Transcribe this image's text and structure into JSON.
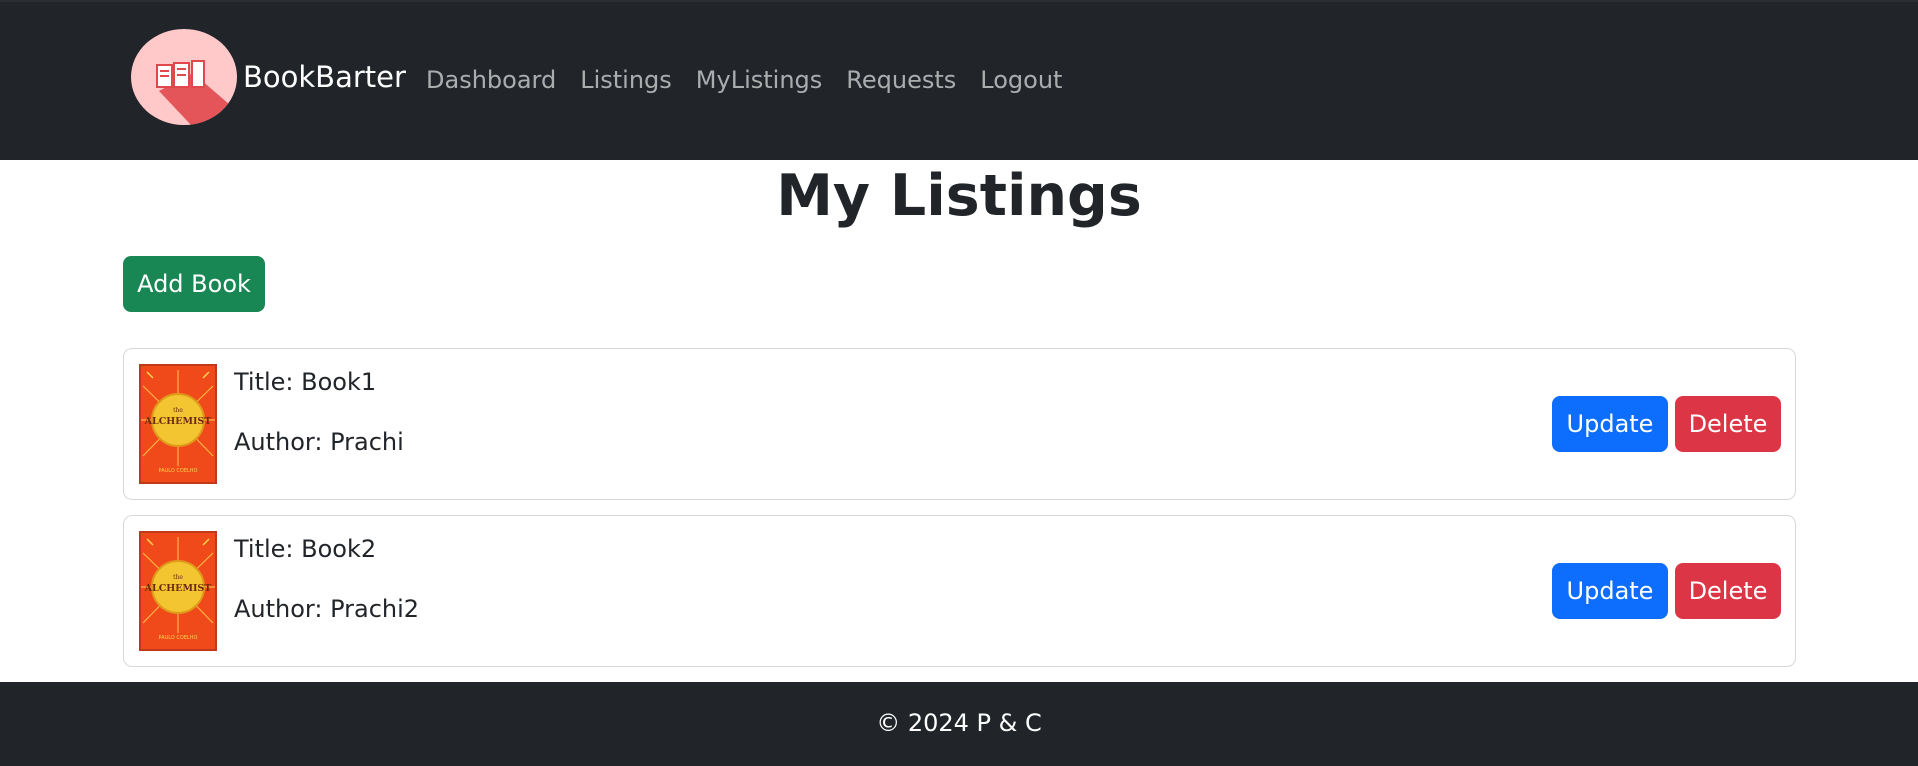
{
  "navbar": {
    "brand": "BookBarter",
    "links": [
      "Dashboard",
      "Listings",
      "MyListings",
      "Requests",
      "Logout"
    ]
  },
  "main": {
    "title": "My Listings",
    "add_button": "Add Book",
    "listings": [
      {
        "title": "Title: Book1",
        "author": "Author: Prachi",
        "update": "Update",
        "delete": "Delete",
        "cover_icon": "book-cover-image"
      },
      {
        "title": "Title: Book2",
        "author": "Author: Prachi2",
        "update": "Update",
        "delete": "Delete",
        "cover_icon": "book-cover-image"
      }
    ]
  },
  "footer": {
    "text": "© 2024 P & C"
  },
  "colors": {
    "navbar_bg": "#212529",
    "success": "#198754",
    "primary": "#0d6efd",
    "danger": "#dc3545"
  }
}
